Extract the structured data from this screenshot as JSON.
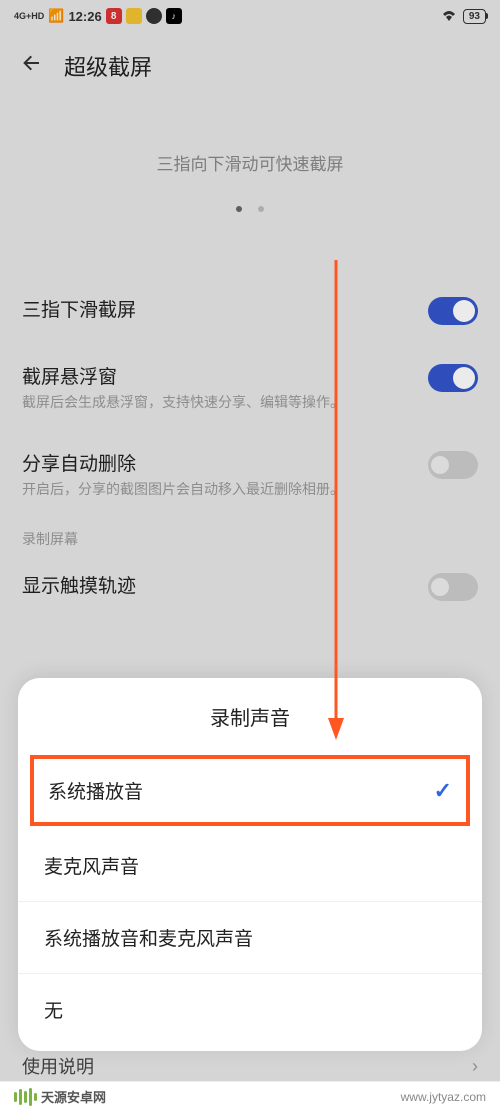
{
  "status_bar": {
    "network": "4G+HD",
    "time": "12:26",
    "battery": "93"
  },
  "header": {
    "title": "超级截屏"
  },
  "preview": {
    "hint": "三指向下滑动可快速截屏"
  },
  "settings": [
    {
      "title": "三指下滑截屏",
      "desc": "",
      "toggle": "on"
    },
    {
      "title": "截屏悬浮窗",
      "desc": "截屏后会生成悬浮窗，支持快速分享、编辑等操作。",
      "toggle": "on"
    },
    {
      "title": "分享自动删除",
      "desc": "开启后，分享的截图图片会自动移入最近删除相册。",
      "toggle": "off"
    }
  ],
  "section_label": "录制屏幕",
  "touch_trace": {
    "title": "显示触摸轨迹",
    "toggle": "off"
  },
  "modal": {
    "title": "录制声音",
    "options": [
      {
        "label": "系统播放音",
        "selected": true
      },
      {
        "label": "麦克风声音",
        "selected": false
      },
      {
        "label": "系统播放音和麦克风声音",
        "selected": false
      },
      {
        "label": "无",
        "selected": false
      }
    ]
  },
  "usage": {
    "label": "使用说明"
  },
  "footer": {
    "brand": "天源安卓网",
    "url": "www.jytyaz.com"
  },
  "annotation": {
    "arrow_color": "#ff5722"
  }
}
